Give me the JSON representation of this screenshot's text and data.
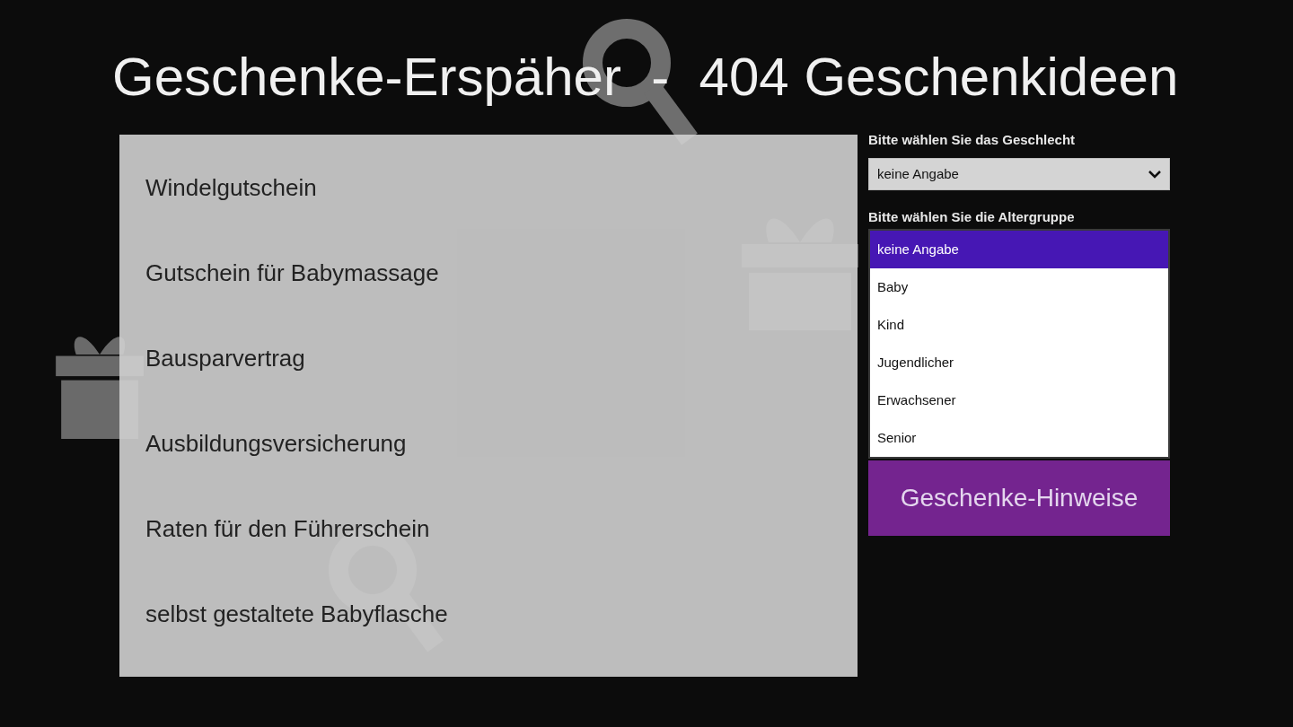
{
  "title": "Geschenke-Erspäher  -  404 Geschenkideen",
  "ideas": [
    "Windelgutschein",
    "Gutschein für Babymassage",
    "Bausparvertrag",
    "Ausbildungsversicherung",
    "Raten für den Führerschein",
    "selbst gestaltete Babyflasche"
  ],
  "gender_select": {
    "label": "Bitte wählen Sie das Geschlecht",
    "value": "keine Angabe"
  },
  "age_select": {
    "label": "Bitte wählen Sie die Altergruppe",
    "expanded": true,
    "options": [
      {
        "label": "keine Angabe",
        "selected": true
      },
      {
        "label": "Baby",
        "selected": false
      },
      {
        "label": "Kind",
        "selected": false
      },
      {
        "label": "Jugendlicher",
        "selected": false
      },
      {
        "label": "Erwachsener",
        "selected": false
      },
      {
        "label": "Senior",
        "selected": false
      }
    ]
  },
  "button": "Geschenke-Hinweise"
}
